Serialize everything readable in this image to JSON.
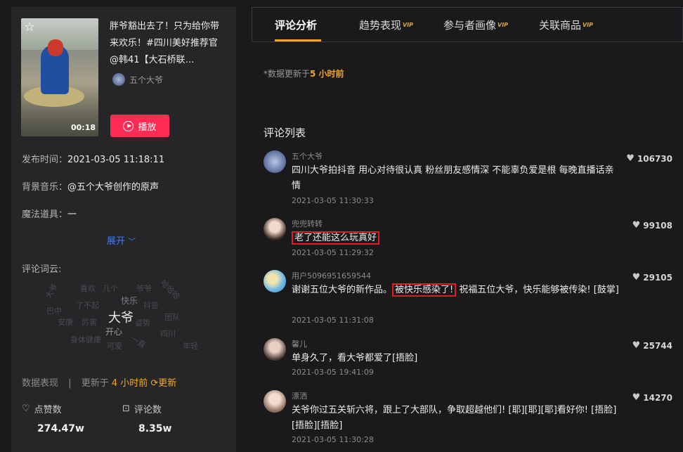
{
  "video": {
    "duration": "00:18",
    "title": "胖爷豁出去了！只为给你带来欢乐！#四川美好推荐官 @韩41【大石桥联…",
    "author": "五个大爷",
    "play_label": "播放",
    "publish_label": "发布时间：",
    "publish_time": "2021-03-05 11:18:11",
    "music_label": "背景音乐：",
    "music": "@五个大爷创作的原声",
    "prop_label": "魔法道具：",
    "prop": "一",
    "expand_label": "展开"
  },
  "wordcloud": {
    "label": "评论词云:",
    "words": [
      "大爷",
      "开心",
      "快乐",
      "抖音",
      "团队",
      "四川",
      "巴中",
      "安康",
      "厉害",
      "了不起",
      "喜欢",
      "几个",
      "爷爷",
      "哈哈哈",
      "身体健康",
      "可爱",
      "一直",
      "年轻",
      "姿势",
      "大爷"
    ]
  },
  "stats": {
    "label": "数据表现",
    "sep": "|",
    "update_prefix": "更新于",
    "update_time": "4 小时前",
    "refresh_label": "更新",
    "likes_label": "点赞数",
    "likes_value": "274.47w",
    "comments_label": "评论数",
    "comments_value": "8.35w"
  },
  "tabs": [
    {
      "label": "评论分析",
      "vip": ""
    },
    {
      "label": "趋势表现",
      "vip": "VIP"
    },
    {
      "label": "参与者画像",
      "vip": "VIP"
    },
    {
      "label": "关联商品",
      "vip": "VIP"
    }
  ],
  "update_note": {
    "prefix": "*数据更新于",
    "time": "5 小时前"
  },
  "comment_list_title": "评论列表",
  "comments": [
    {
      "name": "五个大爷",
      "text": "四川大爷拍抖音 用心对待很认真 粉丝朋友感情深 不能辜负爱是根 每晚直播话亲情",
      "time": "2021-03-05 11:30:33",
      "likes": "106730"
    },
    {
      "name": "兜兜转转",
      "text": "老了还能这么玩真好",
      "time": "2021-03-05 11:29:32",
      "likes": "99108"
    },
    {
      "name": "用户5096951659544",
      "text_a": "谢谢五位大爷的新作品。",
      "text_b": "被快乐感染了!",
      "text_c": " 祝福五位大爷，快乐能够被传染! [鼓掌]",
      "time": "2021-03-05 11:31:08",
      "likes": "29105"
    },
    {
      "name": "馨儿",
      "text": "单身久了，看大爷都爱了[捂脸]",
      "time": "2021-03-05 19:41:09",
      "likes": "25744"
    },
    {
      "name": "漂洒",
      "text": "关爷你过五关斩六将，跟上了大部队，争取超越他们! [耶][耶][耶]看好你! [捂脸][捂脸][捂脸]",
      "time": "2021-03-05 11:30:28",
      "likes": "14270"
    }
  ]
}
